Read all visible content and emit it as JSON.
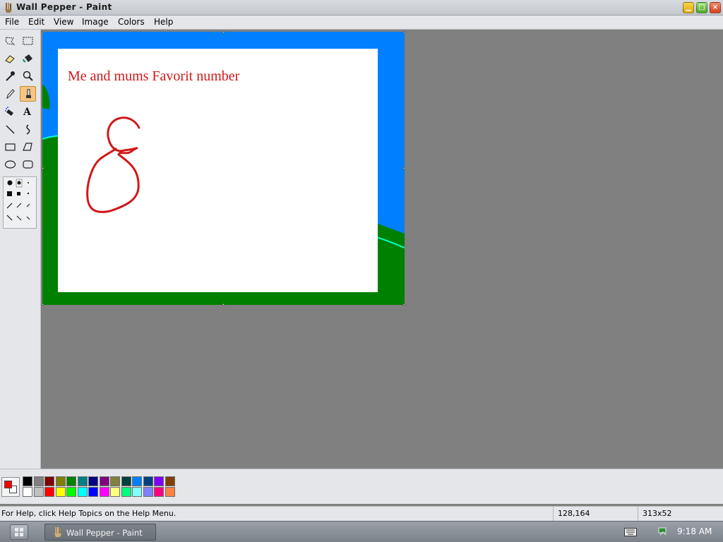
{
  "window": {
    "title": "Wall Pepper - Paint"
  },
  "menu": {
    "items": [
      "File",
      "Edit",
      "View",
      "Image",
      "Colors",
      "Help"
    ]
  },
  "toolbox": {
    "tools": [
      {
        "name": "free-form-select-icon"
      },
      {
        "name": "rectangle-select-icon"
      },
      {
        "name": "eraser-icon"
      },
      {
        "name": "fill-bucket-icon"
      },
      {
        "name": "color-picker-icon"
      },
      {
        "name": "magnifier-icon"
      },
      {
        "name": "pencil-icon"
      },
      {
        "name": "brush-icon"
      },
      {
        "name": "airbrush-icon"
      },
      {
        "name": "text-icon",
        "glyph": "A"
      },
      {
        "name": "line-icon"
      },
      {
        "name": "curve-icon"
      },
      {
        "name": "rectangle-icon"
      },
      {
        "name": "polygon-icon"
      },
      {
        "name": "ellipse-icon"
      },
      {
        "name": "rounded-rectangle-icon"
      }
    ],
    "active_tool": "brush-icon"
  },
  "canvas": {
    "text": "Me and mums Favorit number",
    "handwritten_number": "8",
    "colors": {
      "sky": "#0080ff",
      "grass": "#008000",
      "horizon": "#00ffcc",
      "paper": "#ffffff",
      "ink": "#d11818"
    }
  },
  "palette": {
    "foreground": "#ff0000",
    "background": "#ffffff",
    "top": [
      "#000000",
      "#808080",
      "#800000",
      "#808000",
      "#008000",
      "#008080",
      "#000080",
      "#800080",
      "#808040",
      "#004040",
      "#0080ff",
      "#004080",
      "#8000ff",
      "#804000"
    ],
    "bottom": [
      "#ffffff",
      "#c0c0c0",
      "#ff0000",
      "#ffff00",
      "#00ff00",
      "#00ffff",
      "#0000ff",
      "#ff00ff",
      "#ffff80",
      "#00ff80",
      "#80ffff",
      "#8080ff",
      "#ff0080",
      "#ff8040"
    ]
  },
  "status": {
    "help": "For Help, click Help Topics on the Help Menu.",
    "coords": "128,164",
    "size": "313x52"
  },
  "taskbar": {
    "task_label": "Wall Pepper - Paint",
    "clock": "9:18 AM"
  }
}
